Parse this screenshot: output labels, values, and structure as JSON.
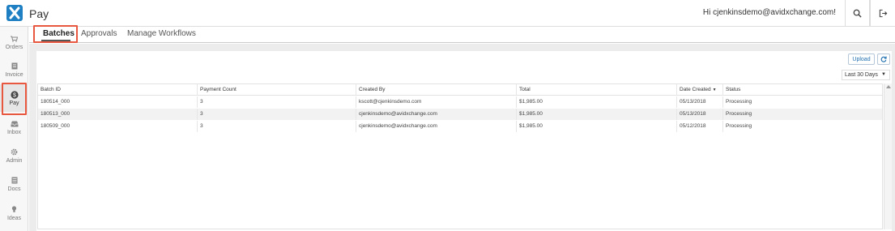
{
  "header": {
    "app_title": "Pay",
    "greeting": "Hi cjenkinsdemo@avidxchange.com!",
    "logo_icon": "x-logo-icon",
    "search_icon": "search-icon",
    "logout_icon": "logout-icon"
  },
  "sidebar": {
    "items": [
      {
        "label": "Orders",
        "icon": "cart-icon"
      },
      {
        "label": "Invoice",
        "icon": "invoice-icon"
      },
      {
        "label": "Pay",
        "icon": "dollar-icon",
        "active": true
      },
      {
        "label": "Inbox",
        "icon": "inbox-icon"
      },
      {
        "label": "Admin",
        "icon": "gear-icon"
      },
      {
        "label": "Docs",
        "icon": "docs-icon"
      },
      {
        "label": "Ideas",
        "icon": "lightbulb-icon"
      }
    ]
  },
  "tabs": {
    "items": [
      {
        "label": "Batches",
        "active": true
      },
      {
        "label": "Approvals"
      },
      {
        "label": "Manage Workflows"
      }
    ]
  },
  "toolbar": {
    "upload_label": "Upload",
    "refresh_icon": "refresh-icon",
    "date_range": "Last 30 Days"
  },
  "table": {
    "columns": [
      "Batch ID",
      "Payment Count",
      "Created By",
      "Total",
      "Date Created",
      "Status"
    ],
    "sort_indicator": "▼",
    "rows": [
      [
        "180514_000",
        "3",
        "kscott@cjenkinsdemo.com",
        "$1,985.00",
        "05/13/2018",
        "Processing"
      ],
      [
        "180513_000",
        "3",
        "cjenkinsdemo@avidxchange.com",
        "$1,985.00",
        "05/13/2018",
        "Processing"
      ],
      [
        "180509_000",
        "3",
        "cjenkinsdemo@avidxchange.com",
        "$1,985.00",
        "05/12/2018",
        "Processing"
      ]
    ]
  },
  "colors": {
    "accent": "#1e7fc2",
    "highlight": "#e8573f",
    "content_bg": "#ececec"
  }
}
